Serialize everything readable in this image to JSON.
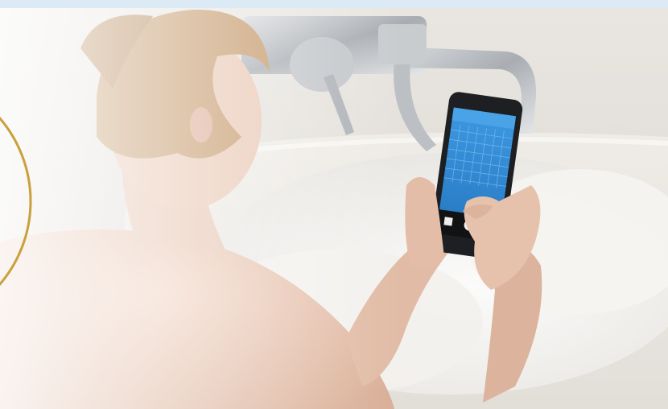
{
  "scene": {
    "frame_color": "#dbeaf5",
    "background_color": "#e7e4df",
    "tub_color": "#f2f0ec",
    "foam_color": "#f7f7f5",
    "faucet_color": "#b9bcc0",
    "skin_color": "#e2bda7",
    "hair_color": "#c69a6a",
    "accent_ring_color": "#c9a03a",
    "phone_body_color": "#1d1f22",
    "phone_screen_color": "#2f89d6",
    "phone_header_color": "#4aa3e6"
  }
}
